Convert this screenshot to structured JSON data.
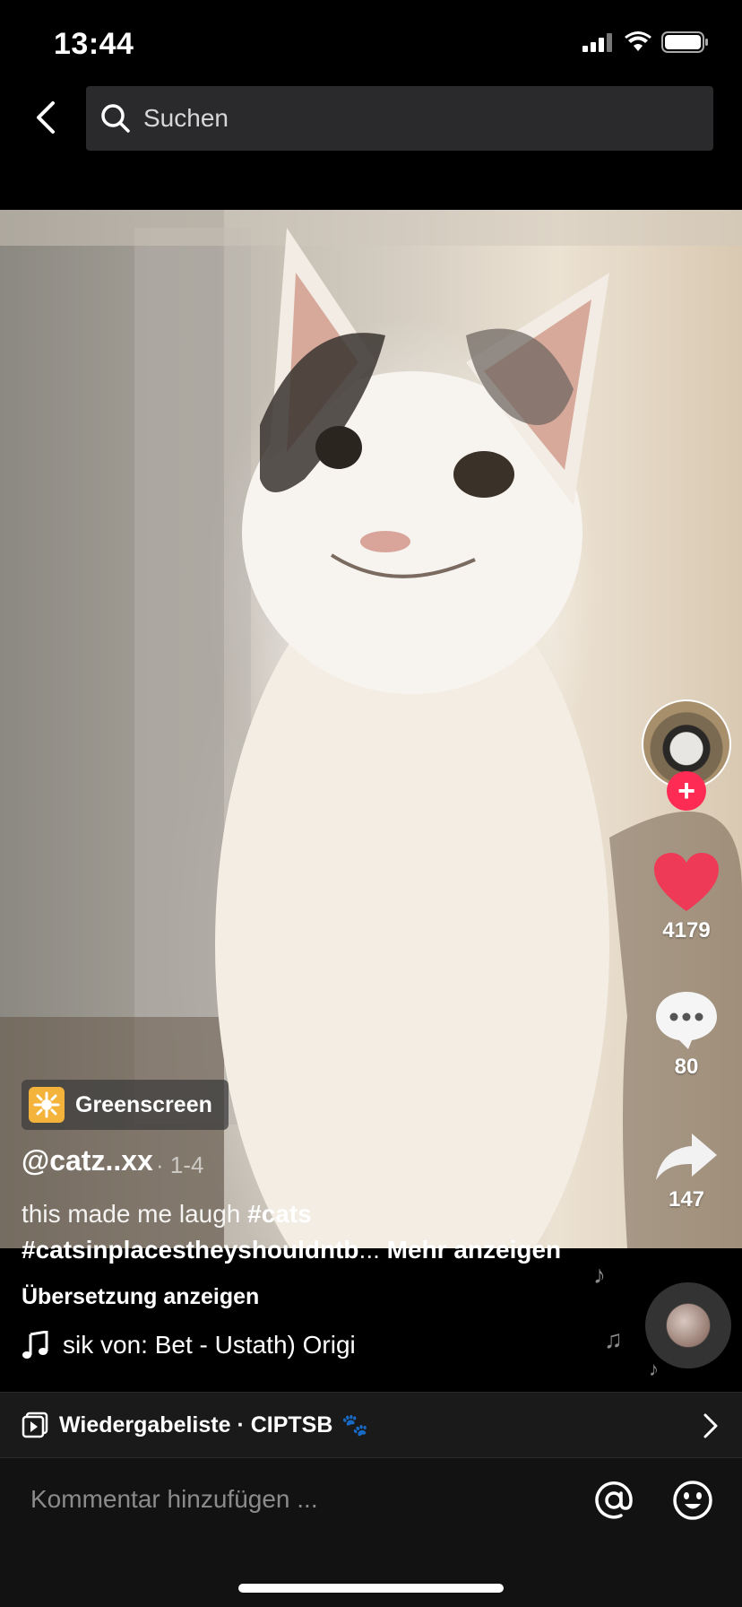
{
  "status_bar": {
    "time": "13:44",
    "icons": [
      "signal-icon",
      "wifi-icon",
      "battery-icon"
    ]
  },
  "search": {
    "placeholder": "Suchen"
  },
  "video": {
    "effect_label": "Greenscreen",
    "username": "@catz..xx",
    "date": "· 1-4",
    "caption_plain": "this made me laugh ",
    "caption_tag1": "#cats",
    "caption_tag2": "#catsinplacestheyshouldntb",
    "caption_ellipsis": "...",
    "more_label": " Mehr anzeigen",
    "translate_label": "Übersetzung anzeigen",
    "music_text": "sik von: Bet - Ustath)    Origi"
  },
  "actions": {
    "likes": "4179",
    "comments": "80",
    "shares": "147",
    "follow_symbol": "+"
  },
  "playlist": {
    "label": "Wiedergabeliste · CIPTSB",
    "decor": "🐾"
  },
  "comment": {
    "placeholder": "Kommentar hinzufügen ..."
  },
  "colors": {
    "accent": "#fe2c55",
    "effect_badge": "#f4b33a",
    "search_bg": "#2a2a2c"
  }
}
